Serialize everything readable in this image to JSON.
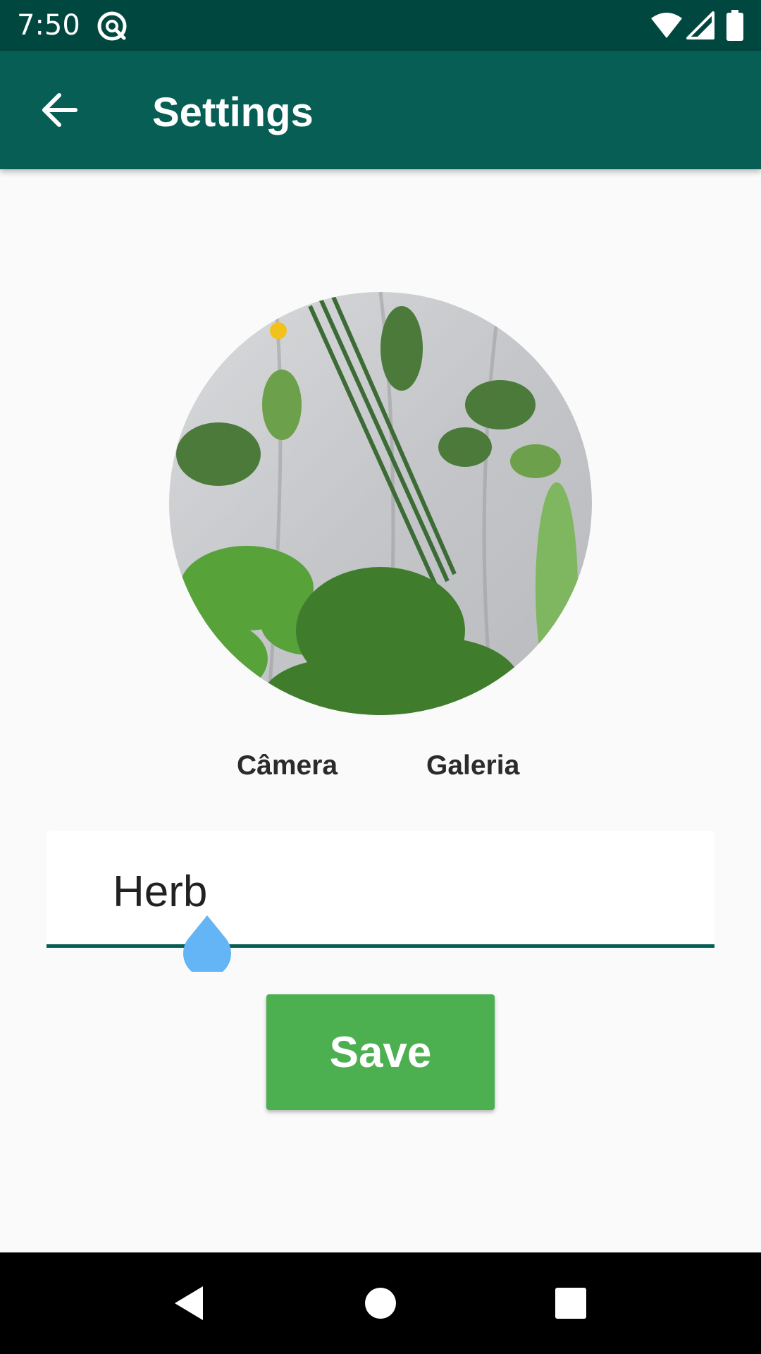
{
  "status_bar": {
    "time": "7:50",
    "icons": [
      "app-notification-icon",
      "wifi-icon",
      "cell-signal-icon",
      "battery-icon"
    ]
  },
  "app_bar": {
    "back_icon": "arrow-back-icon",
    "title": "Settings"
  },
  "photo": {
    "subject": "plant-photo-herbs"
  },
  "photo_actions": {
    "camera_label": "Câmera",
    "gallery_label": "Galeria"
  },
  "name_field": {
    "value": "Herb"
  },
  "save_button": {
    "label": "Save"
  },
  "nav_bar": {
    "icons": [
      "nav-back-icon",
      "nav-home-icon",
      "nav-recents-icon"
    ]
  },
  "colors": {
    "status_bar": "#00473f",
    "app_bar": "#075e55",
    "accent_underline": "#075e55",
    "save_button": "#4caf50",
    "cursor_handle": "#64b5f6",
    "background": "#fafafa"
  }
}
